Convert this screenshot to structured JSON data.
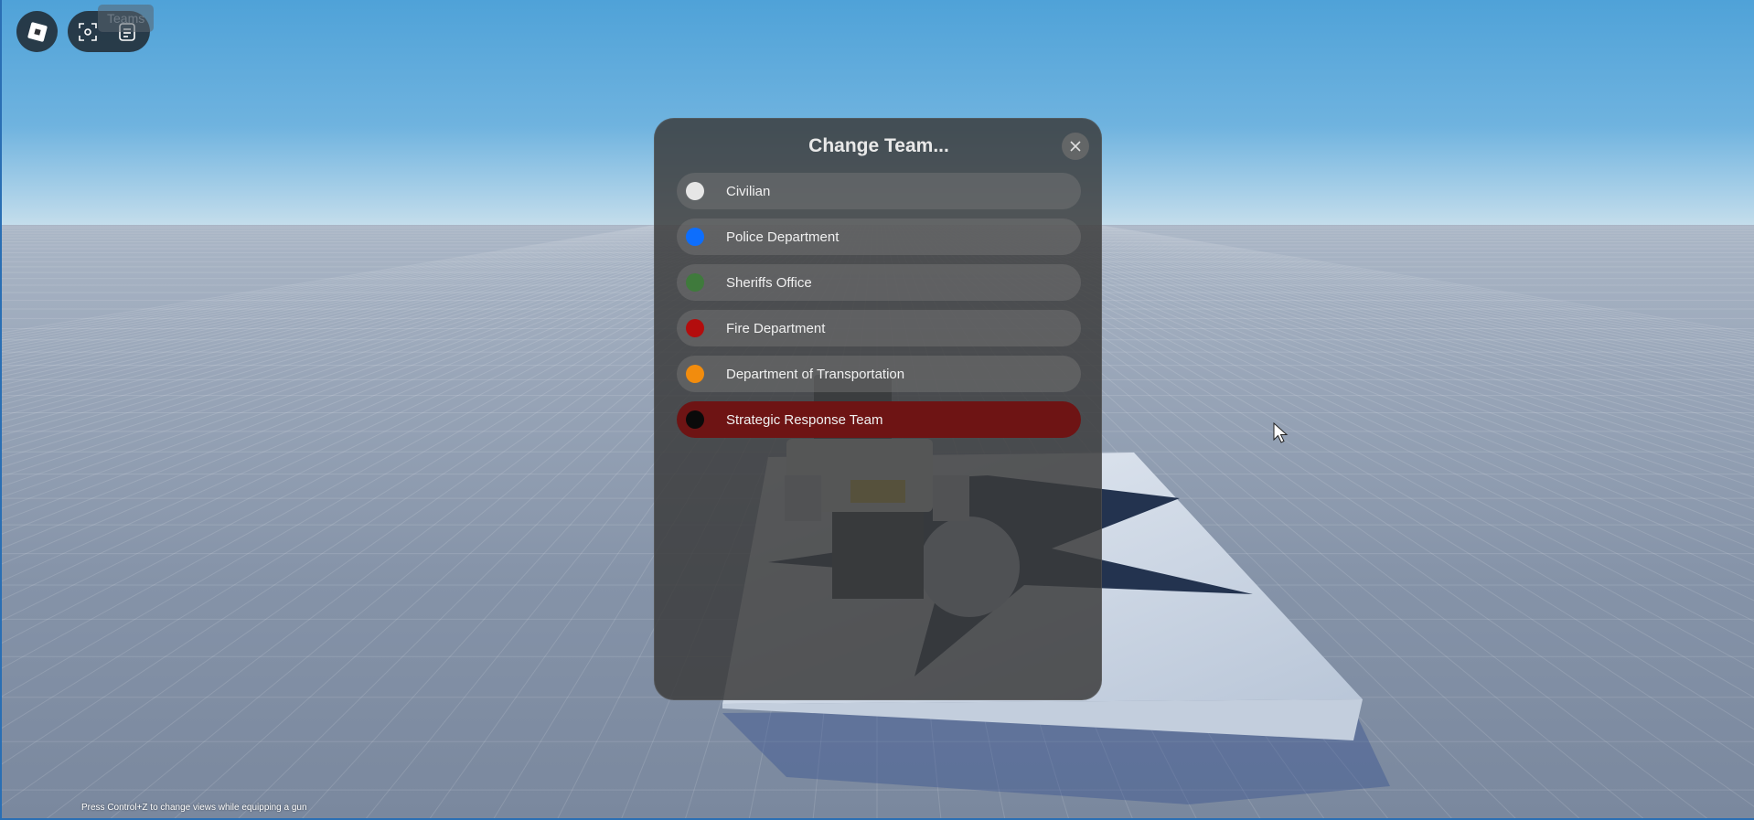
{
  "topbar": {
    "roblox_menu_icon": "roblox-logo-icon",
    "selfview_icon": "selfview-icon",
    "chat_icon": "chat-icon",
    "tooltip_text": "Teams"
  },
  "dialog": {
    "title": "Change Team...",
    "close_icon": "close-icon",
    "teams": [
      {
        "label": "Civilian",
        "color": "#e6e6e6",
        "selected": false
      },
      {
        "label": "Police Department",
        "color": "#0d6efd",
        "selected": false
      },
      {
        "label": "Sheriffs Office",
        "color": "#3f7a3c",
        "selected": false
      },
      {
        "label": "Fire Department",
        "color": "#b30d0d",
        "selected": false
      },
      {
        "label": "Department of Transportation",
        "color": "#f28c0d",
        "selected": false
      },
      {
        "label": "Strategic Response Team",
        "color": "#0a0a0a",
        "selected": true
      }
    ],
    "selected_row_color": "#6e1414"
  },
  "hint_text": "Press Control+Z to change views while equipping a gun",
  "colors": {
    "sky_top": "#4fa2d8",
    "ground": "#8e9bb0"
  }
}
